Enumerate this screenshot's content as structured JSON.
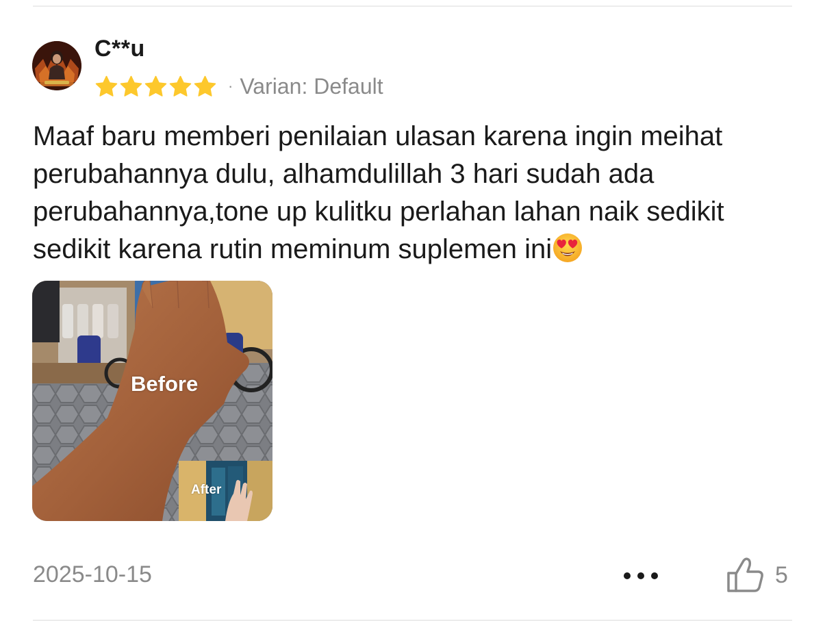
{
  "review": {
    "username": "C**u",
    "rating": 5,
    "rating_max": 5,
    "separator": "·",
    "variant": "Varian: Default",
    "text": "Maaf baru memberi penilaian ulasan karena ingin meihat perubahannya dulu, alhamdulillah 3 hari sudah ada perubahannya,tone up kulitku perlahan lahan naik sedikit sedikit karena rutin meminum suplemen ini",
    "emoji": "smiling-face-with-heart-eyes",
    "photo": {
      "before_label": "Before",
      "after_label": "After"
    },
    "date": "2025-10-15",
    "like_count": "5"
  },
  "colors": {
    "star": "#FDC82C",
    "muted_text": "#8A8A8A",
    "divider": "#ECECEC"
  },
  "icons": {
    "avatar": "avatar-image",
    "more": "ellipsis-icon",
    "like": "thumbs-up-icon"
  }
}
